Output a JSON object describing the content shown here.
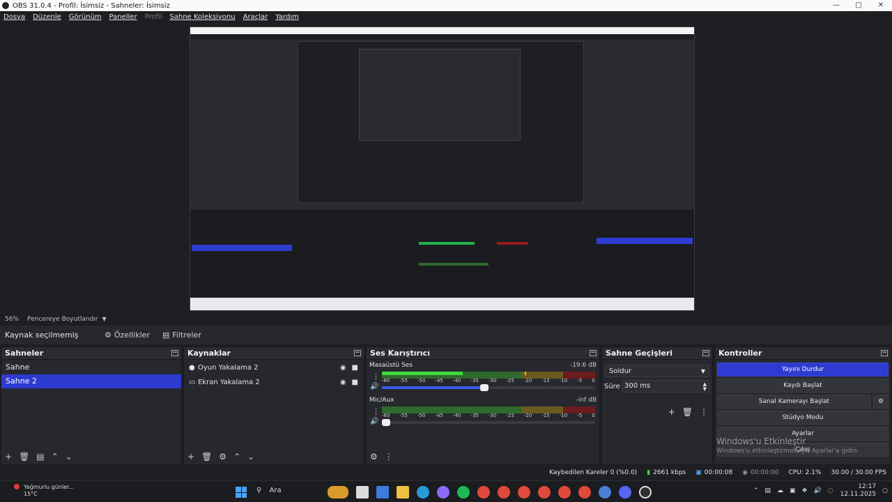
{
  "window": {
    "title": "OBS 31.0.4 - Profil: İsimsiz - Sahneler: İsimsiz"
  },
  "menu": [
    "Dosya",
    "Düzenle",
    "Görünüm",
    "Paneller",
    "Profil",
    "Sahne Koleksiyonu",
    "Araçlar",
    "Yardım"
  ],
  "preview_toolbar": {
    "zoom": "56%",
    "mode": "Pencereye Boyutlandır"
  },
  "selection_bar": {
    "label": "Kaynak seçilmemiş",
    "properties": "Özellikler",
    "filters": "Filtreler"
  },
  "scenes": {
    "title": "Sahneler",
    "items": [
      "Sahne",
      "Sahne 2"
    ],
    "active_index": 1
  },
  "sources": {
    "title": "Kaynaklar",
    "items": [
      {
        "name": "Oyun Yakalama 2",
        "icon": "gamepad-icon"
      },
      {
        "name": "Ekran Yakalama 2",
        "icon": "monitor-icon"
      }
    ]
  },
  "mixer": {
    "title": "Ses Karıştırıcı",
    "ticks": [
      "-60",
      "-55",
      "-50",
      "-45",
      "-40",
      "-35",
      "-30",
      "-25",
      "-20",
      "-15",
      "-10",
      "-5",
      "0"
    ],
    "channels": [
      {
        "name": "Masaüstü Ses",
        "db": "-19.6 dB",
        "level": 0.38,
        "peak": 0.67,
        "volume": 0.48
      },
      {
        "name": "Mic/Aux",
        "db": "-inf dB",
        "level": 0.0,
        "peak": null,
        "volume": 0.02
      }
    ]
  },
  "transitions": {
    "title": "Sahne Geçişleri",
    "type": "Soldur",
    "duration_label": "Süre",
    "duration": "300 ms"
  },
  "controls": {
    "title": "Kontroller",
    "buttons": [
      "Yayını Durdur",
      "Kaydı Başlat",
      "Sanal Kamerayı Başlat",
      "Stüdyo Modu",
      "Ayarlar",
      "Çıkış"
    ]
  },
  "watermark": {
    "line1": "Windows'u Etkinleştir",
    "line2": "Windows'u etkinleştirmek için Ayarlar'a gidin."
  },
  "status": {
    "dropped": "Kaybedilen Kareler 0 (%0.0)",
    "bitrate": "2661 kbps",
    "stream_time": "00:00:08",
    "rec_time": "00:00:00",
    "cpu": "CPU: 2.1%",
    "fps": "30.00 / 30.00 FPS"
  },
  "taskbar": {
    "weather_line1": "Yağmurlu günler...",
    "weather_line2": "15°C",
    "search": "Ara",
    "time": "12:17",
    "date": "12.11.2025"
  },
  "colors": {
    "accent": "#2d3bd1",
    "panel": "#27282d",
    "background": "#1e1f23"
  }
}
